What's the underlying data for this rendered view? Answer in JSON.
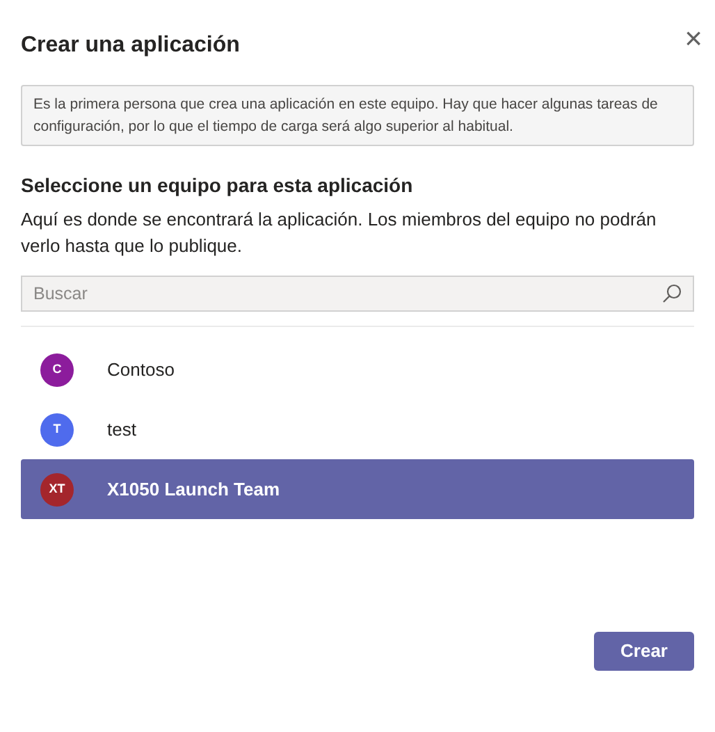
{
  "dialog": {
    "title": "Crear una aplicación",
    "close_icon": "×"
  },
  "notice": "Es la primera persona que crea una aplicación en este equipo. Hay que hacer algunas tareas de configuración, por lo que el tiempo de carga será algo superior al habitual.",
  "section_title": "Seleccione un equipo para esta aplicación",
  "section_description": "Aquí es donde se encontrará la aplicación. Los miembros del equipo no podrán verlo hasta que lo publique.",
  "search": {
    "placeholder": "Buscar"
  },
  "teams": [
    {
      "initials": "C",
      "name": "Contoso",
      "color": "#8c1c9c",
      "selected": false
    },
    {
      "initials": "T",
      "name": "test",
      "color": "#4f6bed",
      "selected": false
    },
    {
      "initials": "XT",
      "name": "X1050 Launch Team",
      "color": "#a4262c",
      "selected": true
    }
  ],
  "primary_button": "Crear"
}
